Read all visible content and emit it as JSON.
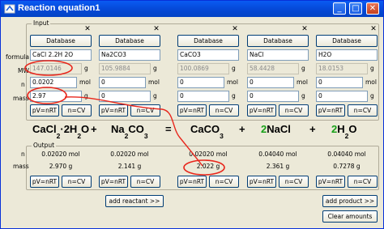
{
  "window": {
    "title": "Reaction equation1"
  },
  "input": {
    "group_label": "Input",
    "row_labels": {
      "formula": "formula",
      "mw": "MW",
      "n": "n",
      "mass": "mass"
    },
    "units": {
      "mw": "g",
      "n": "mol",
      "mass": "g"
    },
    "db_button": "Database",
    "pv_button": "pV=nRT",
    "ncv_button": "n=CV",
    "close_glyph": "✕",
    "columns": [
      {
        "formula": "CaCl 2.2H 2O",
        "mw": "147.0146",
        "n": "0.0202",
        "mass": "2.97"
      },
      {
        "formula": "Na2CO3",
        "mw": "105.9884",
        "n": "0",
        "mass": "0"
      },
      {
        "formula": "CaCO3",
        "mw": "100.0869",
        "n": "0",
        "mass": "0"
      },
      {
        "formula": "NaCl",
        "mw": "58.4428",
        "n": "0",
        "mass": "0"
      },
      {
        "formula": "H2O",
        "mw": "18.0153",
        "n": "0",
        "mass": "0"
      }
    ]
  },
  "equation": {
    "terms": [
      {
        "coef": "",
        "parts": [
          "CaCl",
          "2",
          "·2H",
          "2",
          "O"
        ]
      },
      {
        "coef": "",
        "parts": [
          "Na",
          "2",
          "CO",
          "3",
          ""
        ]
      },
      {
        "coef": "",
        "parts": [
          "CaCO",
          "3",
          "",
          "",
          ""
        ]
      },
      {
        "coef": "2",
        "parts": [
          "NaCl",
          "",
          "",
          "",
          ""
        ]
      },
      {
        "coef": "2",
        "parts": [
          "H",
          "2",
          "O",
          "",
          ""
        ]
      }
    ],
    "operators": [
      "+",
      "=",
      "+",
      "+"
    ]
  },
  "output": {
    "group_label": "Output",
    "row_labels": {
      "n": "n",
      "mass": "mass"
    },
    "columns": [
      {
        "n": "0.02020 mol",
        "mass": "2.970 g"
      },
      {
        "n": "0.02020 mol",
        "mass": "2.141 g"
      },
      {
        "n": "0.02020 mol",
        "mass": "2.022 g"
      },
      {
        "n": "0.04040 mol",
        "mass": "2.361 g"
      },
      {
        "n": "0.04040 mol",
        "mass": "0.7278 g"
      }
    ]
  },
  "actions": {
    "add_reactant": "add reactant >>",
    "add_product": "add product >>",
    "clear_amounts": "Clear amounts"
  },
  "colors": {
    "annotation": "#e8261c",
    "green_coef": "#18a018",
    "titlebar": "#0548d6"
  }
}
